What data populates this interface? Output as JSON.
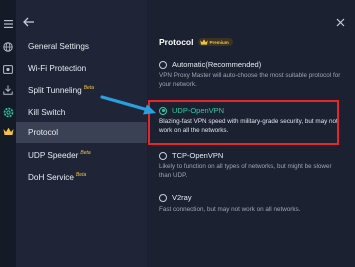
{
  "rail": {
    "icons": [
      "menu-icon",
      "globe-icon",
      "speed-icon",
      "download-icon",
      "settings-gear-icon",
      "crown-icon"
    ]
  },
  "sidebar": {
    "items": [
      {
        "label": "General Settings",
        "beta": ""
      },
      {
        "label": "Wi-Fi Protection",
        "beta": ""
      },
      {
        "label": "Split Tunneling",
        "beta": "Beta"
      },
      {
        "label": "Kill Switch",
        "beta": ""
      },
      {
        "label": "Protocol",
        "beta": ""
      },
      {
        "label": "UDP Speeder",
        "beta": "Beta"
      },
      {
        "label": "DoH Service",
        "beta": "Beta"
      }
    ]
  },
  "main": {
    "title": "Protocol",
    "premium_badge": "Premium",
    "options": [
      {
        "label": "Automatic(Recommended)",
        "selected": false,
        "description": "VPN Proxy Master will auto-choose the most suitable protocol for your network."
      },
      {
        "label": "UDP-OpenVPN",
        "selected": true,
        "description": "Blazing-fast VPN speed with military-grade security, but may not work on all the networks."
      },
      {
        "label": "TCP-OpenVPN",
        "selected": false,
        "description": "Likely to function on all types of networks, but might be slower than UDP."
      },
      {
        "label": "V2ray",
        "selected": false,
        "description": "Fast connection, but may not work on all networks."
      }
    ]
  },
  "colors": {
    "accent": "#31c9a3",
    "highlight": "#e5262a",
    "annotation_arrow": "#2a9fe0",
    "sidebar_active": "#3a4154",
    "premium_gold": "#f1c24b"
  }
}
